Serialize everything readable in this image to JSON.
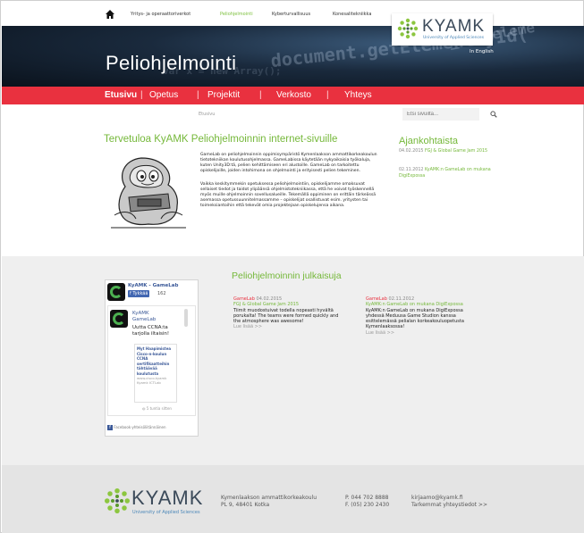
{
  "top_nav": {
    "items": [
      {
        "label": "Yritys- ja operaattoriverkot",
        "active": false
      },
      {
        "label": "Peliohjelmointi",
        "active": true
      },
      {
        "label": "Kyberturvallisuus",
        "active": false
      },
      {
        "label": "Konesalitekniikka",
        "active": false
      }
    ]
  },
  "logo": {
    "word": "KYAMK",
    "subtitle": "University of Applied Sciences"
  },
  "hero": {
    "title": "Peliohjelmointi",
    "language_link": "In English"
  },
  "main_menu": {
    "items": [
      {
        "label": "Etusivu",
        "active": true
      },
      {
        "label": "Opetus",
        "active": false
      },
      {
        "label": "Projektit",
        "active": false
      },
      {
        "label": "Verkosto",
        "active": false
      },
      {
        "label": "Yhteys",
        "active": false
      }
    ],
    "separator": "|"
  },
  "breadcrumb": "Etusivu",
  "search": {
    "placeholder": "Etsi sivuilta..."
  },
  "welcome": {
    "heading": "Tervetuloa KyAMK Peliohjelmoinnin internet-sivuille",
    "paragraph1": [
      "GameLab on peliohjelmoinnin oppimisympäristö Kymenlaakson ammattikorkeakoulun",
      "tietotekniikan koulutusohjelmassa. GameLabissa käytetään nykyaikaisia työkaluja,",
      "kuten Unity3D:tä, pelien kehittämiseen eri alustoille. GameLab on tarkoitettu",
      "opiskelijoille, joiden intohimona on ohjelmointi ja erityisesti pelien tekeminen."
    ],
    "paragraph2": [
      "Vaikka keskitymmekin opetuksessa peliohjelmointiin, opiskelijamme omaksuvat",
      "sellaiset tiedot ja taidot ylipäänsä ohjelmistotekniikassa, että he voivat työskennellä",
      "myös muille ohjelmoinnin sovellusalueille. Tekemällä oppiminen on erittäin tärkeässä",
      "asemassa opetussuunnitelmassamme – opiskelijat osallistuvat esim. yritysten tai",
      "toimeksiantoihin että tekevät omia projektejaan opiskelujensa aikana."
    ]
  },
  "news": {
    "heading": "Ajankohtaista",
    "items": [
      {
        "date": "04.02.2015",
        "title": "FGJ & Global Game Jam 2015"
      },
      {
        "date": "02.11.2012",
        "title": "KyAMK:n GameLab on mukana DigiExpossa"
      }
    ]
  },
  "facebook_widget": {
    "page_name": "KyAMK - GameLab",
    "like_label": "Tykkää",
    "like_count": "162",
    "post_author": "KyAMK GameLab",
    "post_text": "Uutta CCNA:ta tarjolla iltaisin!",
    "link_title": "Myt Haapimistea Cisco-n-koulun CCNA sertifikaatteihin tähtäävää koulutusta",
    "link_domain": "www.cisco.kyamk",
    "link_source": "Kyamk ICTLab",
    "post_time": "5 tuntia sitten",
    "footer": "Facebook-yhteisöliitännäinen"
  },
  "publications": {
    "heading": "Peliohjelmoinnin julkaisuja",
    "items": [
      {
        "source": "GameLab",
        "date": "04.02.2015",
        "title": "FGJ & Global Game Jam 2015",
        "text": [
          "Tiimit muodostuivat todella nopeasti hyvältä",
          "porukalta! The teams were formed quickly and",
          "the atmosphere was awesome!"
        ],
        "more": "Lue lisää >>"
      },
      {
        "source": "GameLab",
        "date": "02.11.2012",
        "title": "KyAMK:n GameLab on mukana DigiExpossa",
        "text": [
          "KyAMK:n GameLab on mukana DigiExpossa",
          "yhdessä Meduusa Game Studion kanssa",
          "esittelemässä pelialan korkeakouluopetusta",
          "Kymenlaaksossa!"
        ],
        "more": "Lue lisää >>"
      }
    ]
  },
  "footer": {
    "logo_word": "KYAMK",
    "logo_subtitle": "University of Applied Sciences",
    "address": [
      "Kymenlaakson ammattikorkeakoulu",
      "PL 9, 48401 Kotka"
    ],
    "phones": [
      "P. 044 702 8888",
      "F. (05) 230 2430"
    ],
    "contact": [
      "kirjaamo@kyamk.fi",
      "Tarkemmat yhteystiedot >>"
    ]
  },
  "colors": {
    "accent_red": "#e9313f",
    "accent_green": "#75b83a",
    "logo_blue": "#3b4a5a"
  }
}
